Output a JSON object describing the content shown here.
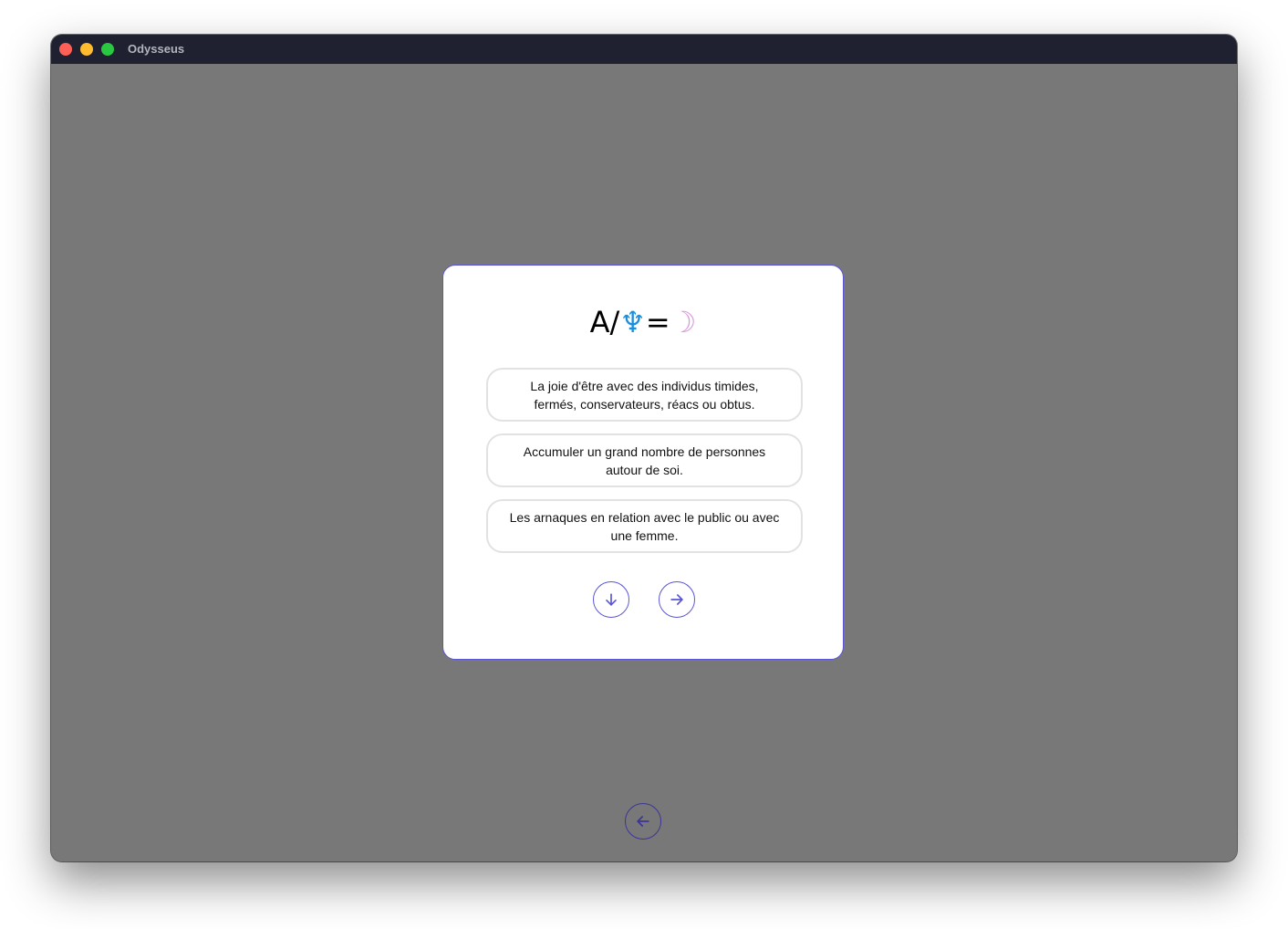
{
  "window": {
    "title": "Odysseus",
    "traffic_lights": [
      "close",
      "minimize",
      "maximize"
    ]
  },
  "card": {
    "formula": {
      "prefix": "A/",
      "symbol1": "♆",
      "operator": "=",
      "symbol2": "☽"
    },
    "options": [
      {
        "text": "La joie d'être avec des individus timides, fermés, conservateurs, réacs ou obtus."
      },
      {
        "text": "Accumuler un grand nombre de personnes autour de soi."
      },
      {
        "text": "Les arnaques en relation avec le public ou avec une femme."
      }
    ],
    "buttons": {
      "down_icon": "arrow-down-icon",
      "next_icon": "arrow-right-icon"
    }
  },
  "footer": {
    "back_icon": "arrow-left-icon"
  },
  "colors": {
    "accent": "#5a55d6",
    "neptune": "#1a8fe0",
    "moon": "#d99ad9",
    "background": "#787878",
    "titlebar": "#1f2130"
  }
}
